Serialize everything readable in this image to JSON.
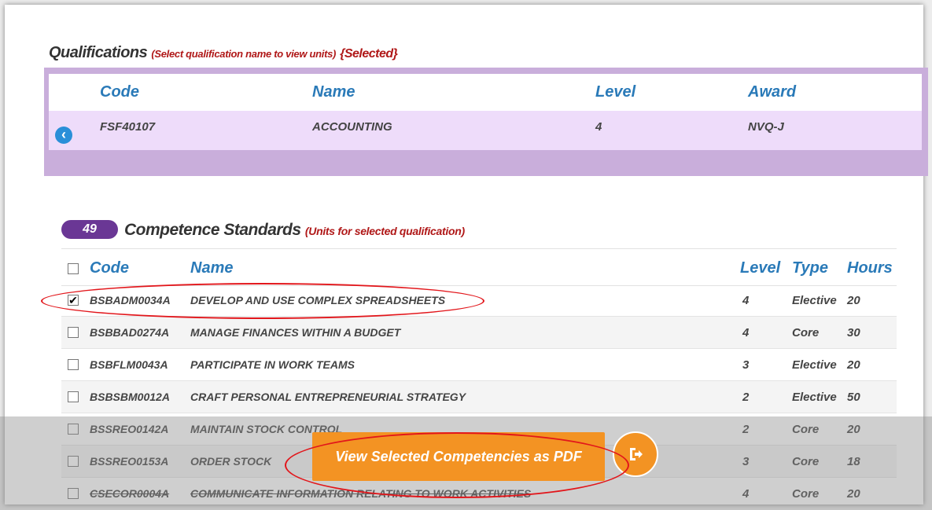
{
  "qualifications": {
    "title": "Qualifications",
    "hint": "(Select qualification name to view units)",
    "selected": "{Selected}",
    "columns": [
      "Code",
      "Name",
      "Level",
      "Award"
    ],
    "row": {
      "code": "FSF40107",
      "name": "ACCOUNTING",
      "level": "4",
      "award": "NVQ-J"
    },
    "back_icon": "chevron-left-circle-icon"
  },
  "competence": {
    "count": "49",
    "title": "Competence Standards",
    "hint": "(Units for selected qualification)",
    "columns": [
      "Code",
      "Name",
      "Level",
      "Type",
      "Hours"
    ],
    "rows": [
      {
        "checked": "✔",
        "code": "BSBADM0034A",
        "name": "DEVELOP AND USE COMPLEX SPREADSHEETS",
        "level": "4",
        "type": "Elective",
        "hours": "20"
      },
      {
        "checked": "",
        "code": "BSBBAD0274A",
        "name": "MANAGE FINANCES WITHIN A BUDGET",
        "level": "4",
        "type": "Core",
        "hours": "30"
      },
      {
        "checked": "",
        "code": "BSBFLM0043A",
        "name": "PARTICIPATE IN WORK TEAMS",
        "level": "3",
        "type": "Elective",
        "hours": "20"
      },
      {
        "checked": "",
        "code": "BSBSBM0012A",
        "name": "CRAFT PERSONAL ENTREPRENEURIAL STRATEGY",
        "level": "2",
        "type": "Elective",
        "hours": "50"
      },
      {
        "checked": "",
        "code": "BSSREO0142A",
        "name": "MAINTAIN STOCK CONTROL",
        "level": "2",
        "type": "Core",
        "hours": "20"
      },
      {
        "checked": "",
        "code": "BSSREO0153A",
        "name": "ORDER STOCK",
        "level": "3",
        "type": "Core",
        "hours": "18"
      },
      {
        "checked": "",
        "code": "CSECOR0004A",
        "name": "COMMUNICATE INFORMATION RELATING TO WORK ACTIVITIES",
        "level": "4",
        "type": "Core",
        "hours": "20"
      }
    ]
  },
  "actions": {
    "pdf_label": "View Selected Competencies as PDF",
    "export_icon": "export-icon"
  },
  "colors": {
    "accent": "#f39323",
    "header_text": "#2a7ab8",
    "badge": "#6a3795",
    "annotation": "#e2161b"
  }
}
